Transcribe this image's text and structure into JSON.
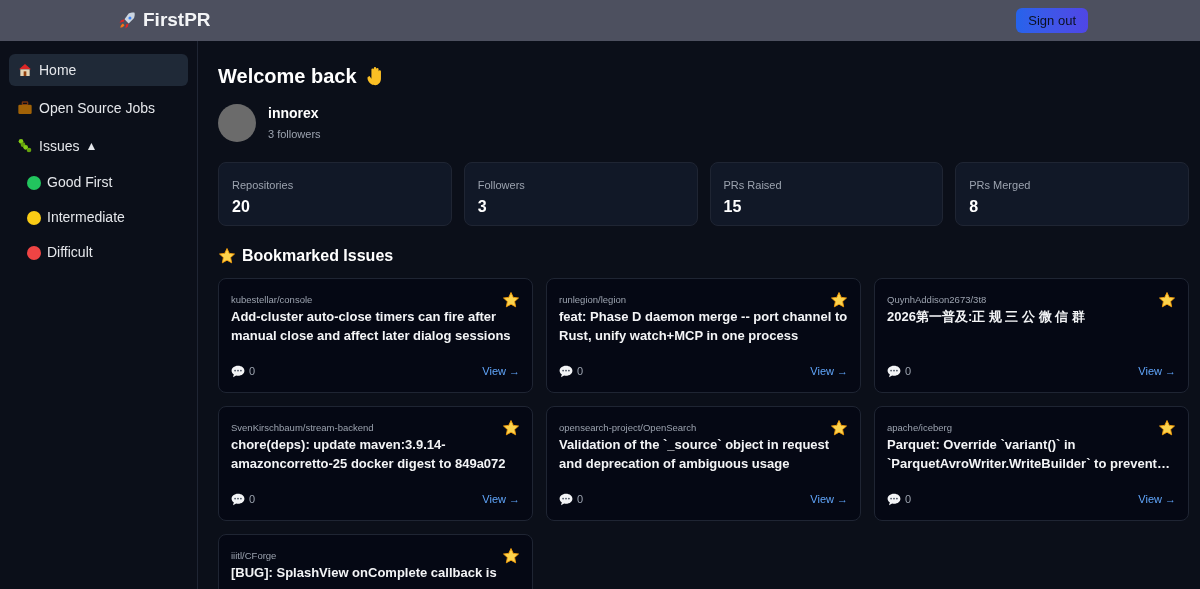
{
  "header": {
    "logo": "FirstPR",
    "sign_out": "Sign out"
  },
  "sidebar": {
    "items": [
      {
        "kind": "link",
        "label": "Home",
        "selected": true
      },
      {
        "kind": "link",
        "label": "Open Source Jobs",
        "selected": false
      },
      {
        "kind": "group",
        "label": "Issues",
        "selected": false,
        "toggle": "▲",
        "expanded": true,
        "children": [
          {
            "label": "Good First",
            "color": "#22c55e",
            "selected": false
          },
          {
            "label": "Intermediate",
            "color": "#facc15",
            "selected": false
          },
          {
            "label": "Difficult",
            "color": "#ef4444",
            "selected": false
          }
        ]
      }
    ]
  },
  "welcome": "Welcome back",
  "profile": {
    "username": "innorex",
    "followers": "3 followers"
  },
  "stats": [
    {
      "label": "Repositories",
      "value": "20"
    },
    {
      "label": "Followers",
      "value": "3"
    },
    {
      "label": "PRs Raised",
      "value": "15"
    },
    {
      "label": "PRs Merged",
      "value": "8"
    }
  ],
  "bookmarks": {
    "title": "Bookmarked Issues",
    "issues": [
      {
        "repo": "kubestellar/console",
        "title": "Add-cluster auto-close timers can fire after manual close and affect later dialog sessions",
        "comments": "0",
        "view": "View →",
        "bookmarked": true
      },
      {
        "repo": "runlegion/legion",
        "title": "feat: Phase D daemon merge -- port channel to Rust, unify watch+MCP in one process",
        "comments": "0",
        "view": "View →",
        "bookmarked": true
      },
      {
        "repo": "QuynhAddison2673/3t8",
        "title": "2026第一普及:正 规 三 公 微 信 群",
        "comments": "0",
        "view": "View →",
        "bookmarked": true
      },
      {
        "repo": "SvenKirschbaum/stream-backend",
        "title": "chore(deps): update maven:3.9.14-amazoncorretto-25 docker digest to 849a072",
        "comments": "0",
        "view": "View →",
        "bookmarked": true
      },
      {
        "repo": "opensearch-project/OpenSearch",
        "title": "Validation of the `_source` object in request and deprecation of ambiguous usage",
        "comments": "0",
        "view": "View →",
        "bookmarked": true
      },
      {
        "repo": "apache/iceberg",
        "title": "Parquet: Override `variant()` in `ParquetAvroWriter.WriteBuilder` to prevent…",
        "comments": "0",
        "view": "View →",
        "bookmarked": true
      },
      {
        "repo": "iiitl/CForge",
        "title": "[BUG]: SplashView onComplete callback is",
        "bookmarked": true
      }
    ]
  }
}
